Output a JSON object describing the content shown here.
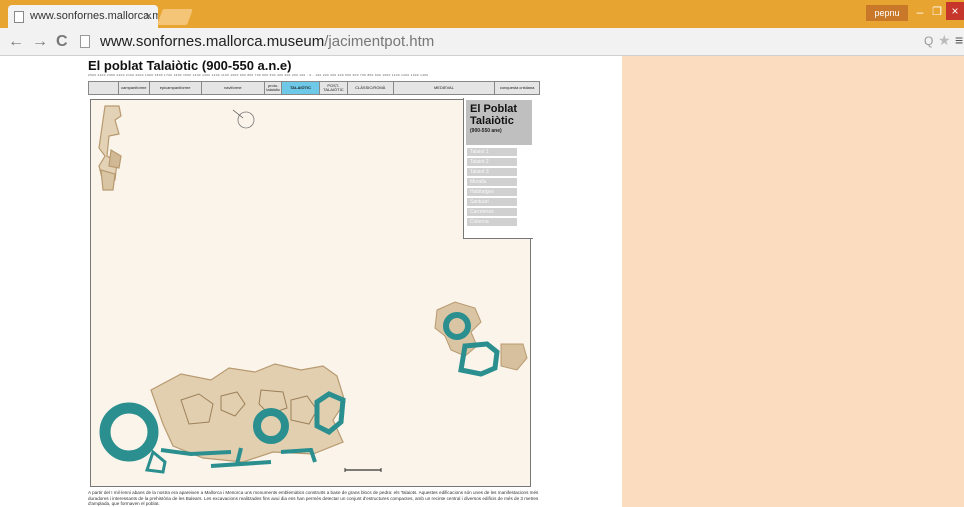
{
  "browser": {
    "tab_title": "www.sonfornes.mallorca.m",
    "tab_close": "×",
    "url_host": "www.sonfornes.mallorca.museum",
    "url_path": "/jacimentpot.htm",
    "user": "pepnu",
    "btn_minimize": "–",
    "btn_maximize": "❐",
    "btn_close": "×",
    "nav_back": "←",
    "nav_forward": "→",
    "nav_reload": "C",
    "zoom": "Q",
    "star": "★",
    "menu": "≡"
  },
  "page": {
    "title": "El poblat Talaiòtic (900-550 a.n.e)",
    "timeline_scale": "2500 2400 2300 2200 2100 2000 1900 1800 1700 1600 1500 1400 1300 1200 1100 1000 900 800 700 600 500 400 300 200 100 - 0 - 100 200 300 400 500 600 700 800 900 1000 1100 1200 1300 1400",
    "periods": [
      {
        "label": "",
        "active": false
      },
      {
        "label": "campaniforme",
        "active": false
      },
      {
        "label": "epicampaniforme",
        "active": false
      },
      {
        "label": "naviforme",
        "active": false
      },
      {
        "label": "proto- talaiòtic",
        "active": false
      },
      {
        "label": "TALAIÒTIC",
        "active": true
      },
      {
        "label": "POST- TALAIÒTIC",
        "active": false
      },
      {
        "label": "CLÀSSIC/ROMÀ",
        "active": false
      },
      {
        "label": "MEDIEVAL",
        "active": false
      },
      {
        "label": "conquesta cristiana",
        "active": false
      }
    ],
    "panel_title_1": "El Poblat",
    "panel_title_2": "Talaiòtic",
    "panel_subtitle": "(900-550 ane)",
    "site_list": [
      "Talaiot 1",
      "Talaiot 2",
      "Talaiot 3",
      "Muralla",
      "Habitatges",
      "Santuari",
      "Carreteres",
      "Cisterna"
    ],
    "caption": "A partir del I mil·lenni abans de la nostra era apareixen a Mallorca i Menorca uns monuments emblemàtics construïts a base de grans blocs de pedra: els Talaiots. Aquestes edificacions són unes de les manifestacions més duradores i interessants de la prehistòria de les Balears. Les excavacions realitzades fins avui dia ens han permès detectar un conjunt d'estructures compactes, amb un recinte central i diversos edificis de més de 3 metres d'amplada, que formaven el poblat."
  },
  "colors": {
    "chrome": "#e8a430",
    "talaiot_teal": "#2a8f8e",
    "stone_tan": "#c9ad86",
    "map_bg": "#fbf4ea",
    "right_bg": "#fcdcbf"
  }
}
